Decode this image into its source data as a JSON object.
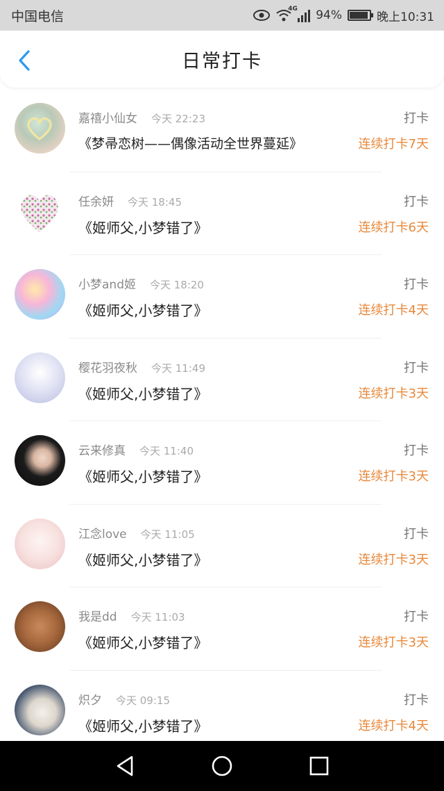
{
  "status_bar": {
    "carrier": "中国电信",
    "network": "4G",
    "battery": "94%",
    "battery_level": 0.94,
    "time": "晚上10:31"
  },
  "header": {
    "title": "日常打卡"
  },
  "entries": [
    {
      "name": "嘉禧小仙女",
      "time": "今天 22:23",
      "book": "《梦帚恋树——偶像活动全世界蔓延》",
      "label": "打卡",
      "streak": "连续打卡7天"
    },
    {
      "name": "任余妍",
      "time": "今天 18:45",
      "book": "《姬师父,小梦错了》",
      "label": "打卡",
      "streak": "连续打卡6天"
    },
    {
      "name": "小梦and姬",
      "time": "今天 18:20",
      "book": "《姬师父,小梦错了》",
      "label": "打卡",
      "streak": "连续打卡4天"
    },
    {
      "name": "樱花羽夜秋",
      "time": "今天 11:49",
      "book": "《姬师父,小梦错了》",
      "label": "打卡",
      "streak": "连续打卡3天"
    },
    {
      "name": "云来修真",
      "time": "今天 11:40",
      "book": "《姬师父,小梦错了》",
      "label": "打卡",
      "streak": "连续打卡3天"
    },
    {
      "name": "江念love",
      "time": "今天 11:05",
      "book": "《姬师父,小梦错了》",
      "label": "打卡",
      "streak": "连续打卡3天"
    },
    {
      "name": "我是dd",
      "time": "今天 11:03",
      "book": "《姬师父,小梦错了》",
      "label": "打卡",
      "streak": "连续打卡3天"
    },
    {
      "name": "炽夕",
      "time": "今天 09:15",
      "book": "《姬师父,小梦错了》",
      "label": "打卡",
      "streak": "连续打卡4天"
    }
  ],
  "colors": {
    "accent_blue": "#2a9bf0",
    "streak_orange": "#e8883a"
  },
  "icons": {
    "back": "chevron-left-icon",
    "nav_back": "triangle-back-icon",
    "nav_home": "circle-home-icon",
    "nav_recent": "square-recent-icon"
  }
}
